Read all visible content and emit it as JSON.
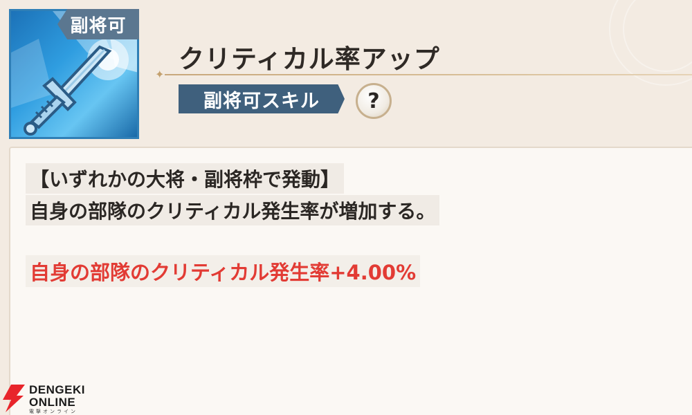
{
  "skill": {
    "tag": "副将可",
    "title": "クリティカル率アップ",
    "badge": "副将可スキル",
    "help_symbol": "?",
    "icon": "sword-icon",
    "accent_color": "#3f607d",
    "effect_color": "#e23b34"
  },
  "description": {
    "line1": "【いずれかの大将・副将枠で発動】",
    "line2": "自身の部隊のクリティカル発生率が増加する。",
    "effect": "自身の部隊のクリティカル発生率+4.00%"
  },
  "watermark": {
    "line1": "DENGEKI",
    "line2": "ONLINE",
    "line3": "電撃オンライン"
  }
}
